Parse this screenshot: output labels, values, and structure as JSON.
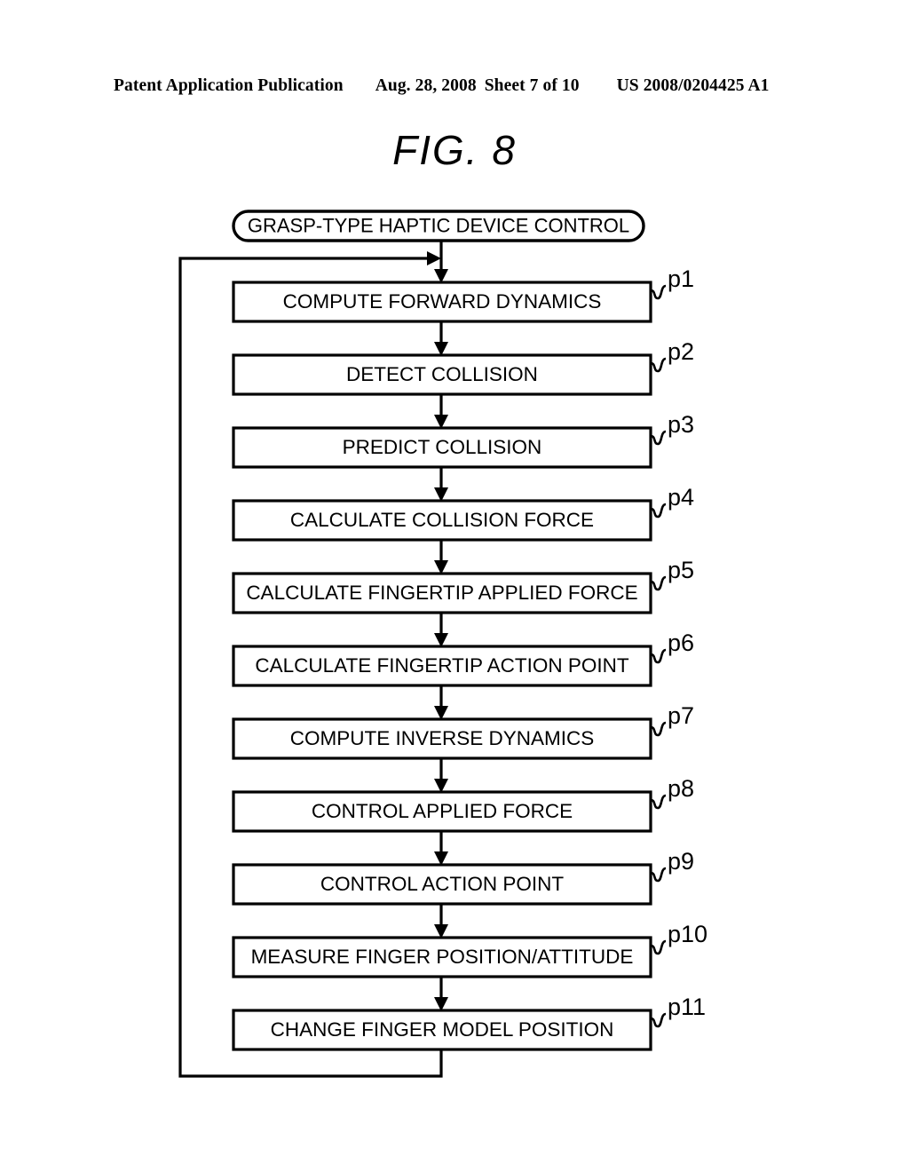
{
  "header": {
    "publication": "Patent Application Publication",
    "date": "Aug. 28, 2008",
    "sheet": "Sheet 7 of 10",
    "patent_number": "US 2008/0204425 A1"
  },
  "figure": {
    "title": "FIG.  8"
  },
  "flowchart": {
    "terminal": {
      "label": "GRASP-TYPE HAPTIC DEVICE CONTROL",
      "shape": "rounded-terminal"
    },
    "steps": [
      {
        "ref": "p1",
        "label": "COMPUTE FORWARD DYNAMICS"
      },
      {
        "ref": "p2",
        "label": "DETECT COLLISION"
      },
      {
        "ref": "p3",
        "label": "PREDICT COLLISION"
      },
      {
        "ref": "p4",
        "label": "CALCULATE COLLISION FORCE"
      },
      {
        "ref": "p5",
        "label": "CALCULATE FINGERTIP APPLIED FORCE"
      },
      {
        "ref": "p6",
        "label": "CALCULATE FINGERTIP ACTION POINT"
      },
      {
        "ref": "p7",
        "label": "COMPUTE INVERSE DYNAMICS"
      },
      {
        "ref": "p8",
        "label": "CONTROL APPLIED FORCE"
      },
      {
        "ref": "p9",
        "label": "CONTROL ACTION POINT"
      },
      {
        "ref": "p10",
        "label": "MEASURE FINGER POSITION/ATTITUDE"
      },
      {
        "ref": "p11",
        "label": "CHANGE FINGER MODEL POSITION"
      }
    ],
    "feedback_loop": {
      "description": "loop-back from last step to start of first step"
    },
    "colors": {
      "ink": "#000000",
      "paper": "#ffffff"
    }
  }
}
